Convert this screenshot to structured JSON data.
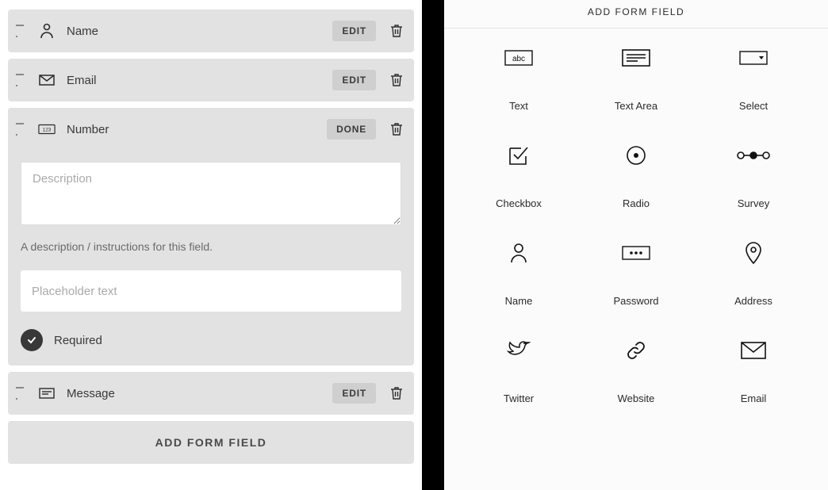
{
  "left": {
    "fields": [
      {
        "label": "Name",
        "action_label": "EDIT"
      },
      {
        "label": "Email",
        "action_label": "EDIT"
      },
      {
        "label": "Number",
        "action_label": "DONE"
      },
      {
        "label": "Message",
        "action_label": "EDIT"
      }
    ],
    "editor": {
      "description_placeholder": "Description",
      "description_helper": "A description / instructions for this field.",
      "placeholder_placeholder": "Placeholder text",
      "required_label": "Required"
    },
    "add_button_label": "ADD FORM FIELD"
  },
  "right": {
    "header": "ADD FORM FIELD",
    "options": [
      "Text",
      "Text Area",
      "Select",
      "Checkbox",
      "Radio",
      "Survey",
      "Name",
      "Password",
      "Address",
      "Twitter",
      "Website",
      "Email"
    ]
  }
}
